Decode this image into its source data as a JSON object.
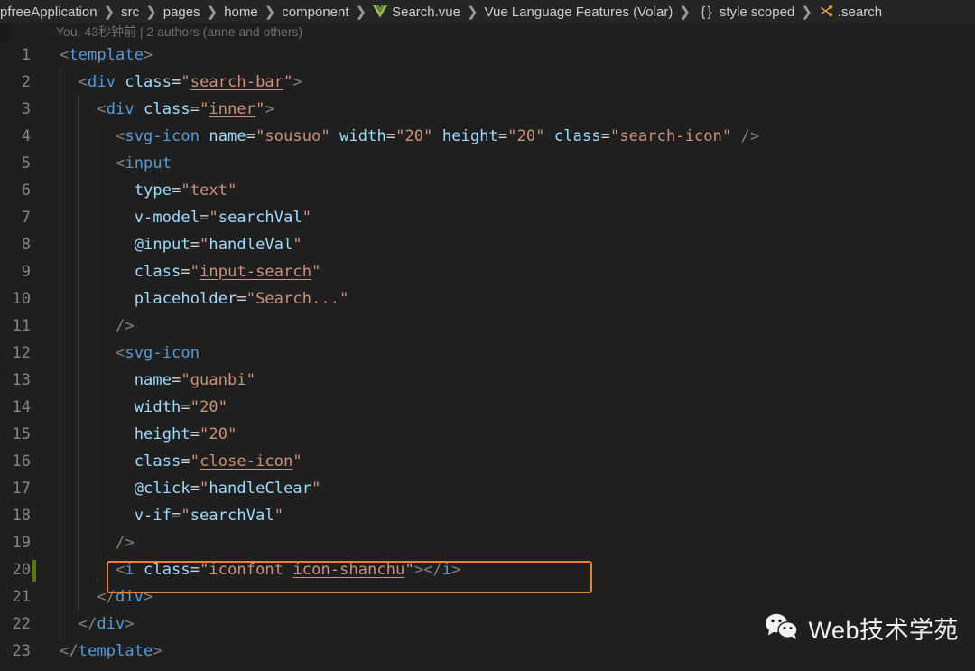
{
  "breadcrumb": {
    "items": [
      {
        "label": "pfreeApplication",
        "icon": "none"
      },
      {
        "label": "src",
        "icon": "none"
      },
      {
        "label": "pages",
        "icon": "none"
      },
      {
        "label": "home",
        "icon": "none"
      },
      {
        "label": "component",
        "icon": "none"
      },
      {
        "label": "Search.vue",
        "icon": "vue-file-icon"
      },
      {
        "label": "Vue Language Features (Volar)",
        "icon": "none"
      },
      {
        "label": "style scoped",
        "icon": "braces-icon"
      },
      {
        "label": ".search",
        "icon": "css-selector-icon"
      }
    ],
    "separator": "❯"
  },
  "blame": {
    "text": "You, 43秒钟前 | 2 authors (anne and others)"
  },
  "editor": {
    "modified_line": 20,
    "highlight_line": 20,
    "lines": [
      {
        "number": "1",
        "indent": 0,
        "tokens": [
          {
            "t": "<",
            "c": "t-punct"
          },
          {
            "t": "template",
            "c": "t-tag"
          },
          {
            "t": ">",
            "c": "t-punct"
          }
        ]
      },
      {
        "number": "2",
        "indent": 1,
        "tokens": [
          {
            "t": "  ",
            "c": "t-punct"
          },
          {
            "t": "<",
            "c": "t-punct"
          },
          {
            "t": "div",
            "c": "t-tag"
          },
          {
            "t": " ",
            "c": "t-punct"
          },
          {
            "t": "class",
            "c": "t-attr"
          },
          {
            "t": "=",
            "c": "t-eq"
          },
          {
            "t": "\"",
            "c": "t-quote"
          },
          {
            "t": "search-bar",
            "c": "t-class"
          },
          {
            "t": "\"",
            "c": "t-quote"
          },
          {
            "t": ">",
            "c": "t-punct"
          }
        ]
      },
      {
        "number": "3",
        "indent": 2,
        "tokens": [
          {
            "t": "    ",
            "c": "t-punct"
          },
          {
            "t": "<",
            "c": "t-punct"
          },
          {
            "t": "div",
            "c": "t-tag"
          },
          {
            "t": " ",
            "c": "t-punct"
          },
          {
            "t": "class",
            "c": "t-attr"
          },
          {
            "t": "=",
            "c": "t-eq"
          },
          {
            "t": "\"",
            "c": "t-quote"
          },
          {
            "t": "inner",
            "c": "t-class"
          },
          {
            "t": "\"",
            "c": "t-quote"
          },
          {
            "t": ">",
            "c": "t-punct"
          }
        ]
      },
      {
        "number": "4",
        "indent": 3,
        "tokens": [
          {
            "t": "      ",
            "c": "t-punct"
          },
          {
            "t": "<",
            "c": "t-punct"
          },
          {
            "t": "svg-icon",
            "c": "t-tag"
          },
          {
            "t": " ",
            "c": "t-punct"
          },
          {
            "t": "name",
            "c": "t-attr"
          },
          {
            "t": "=",
            "c": "t-eq"
          },
          {
            "t": "\"",
            "c": "t-quote"
          },
          {
            "t": "sousuo",
            "c": "t-string"
          },
          {
            "t": "\"",
            "c": "t-quote"
          },
          {
            "t": " ",
            "c": "t-punct"
          },
          {
            "t": "width",
            "c": "t-attr"
          },
          {
            "t": "=",
            "c": "t-eq"
          },
          {
            "t": "\"",
            "c": "t-quote"
          },
          {
            "t": "20",
            "c": "t-string"
          },
          {
            "t": "\"",
            "c": "t-quote"
          },
          {
            "t": " ",
            "c": "t-punct"
          },
          {
            "t": "height",
            "c": "t-attr"
          },
          {
            "t": "=",
            "c": "t-eq"
          },
          {
            "t": "\"",
            "c": "t-quote"
          },
          {
            "t": "20",
            "c": "t-string"
          },
          {
            "t": "\"",
            "c": "t-quote"
          },
          {
            "t": " ",
            "c": "t-punct"
          },
          {
            "t": "class",
            "c": "t-attr"
          },
          {
            "t": "=",
            "c": "t-eq"
          },
          {
            "t": "\"",
            "c": "t-quote"
          },
          {
            "t": "search-icon",
            "c": "t-class"
          },
          {
            "t": "\"",
            "c": "t-quote"
          },
          {
            "t": " />",
            "c": "t-punct"
          }
        ]
      },
      {
        "number": "5",
        "indent": 3,
        "tokens": [
          {
            "t": "      ",
            "c": "t-punct"
          },
          {
            "t": "<",
            "c": "t-punct"
          },
          {
            "t": "input",
            "c": "t-tag"
          }
        ]
      },
      {
        "number": "6",
        "indent": 3,
        "tokens": [
          {
            "t": "        ",
            "c": "t-punct"
          },
          {
            "t": "type",
            "c": "t-attr"
          },
          {
            "t": "=",
            "c": "t-eq"
          },
          {
            "t": "\"",
            "c": "t-quote"
          },
          {
            "t": "text",
            "c": "t-string"
          },
          {
            "t": "\"",
            "c": "t-quote"
          }
        ]
      },
      {
        "number": "7",
        "indent": 3,
        "tokens": [
          {
            "t": "        ",
            "c": "t-punct"
          },
          {
            "t": "v-model",
            "c": "t-attr"
          },
          {
            "t": "=",
            "c": "t-eq"
          },
          {
            "t": "\"",
            "c": "t-quote"
          },
          {
            "t": "searchVal",
            "c": "t-attr"
          },
          {
            "t": "\"",
            "c": "t-quote"
          }
        ]
      },
      {
        "number": "8",
        "indent": 3,
        "tokens": [
          {
            "t": "        ",
            "c": "t-punct"
          },
          {
            "t": "@input",
            "c": "t-attr"
          },
          {
            "t": "=",
            "c": "t-eq"
          },
          {
            "t": "\"",
            "c": "t-quote"
          },
          {
            "t": "handleVal",
            "c": "t-attr"
          },
          {
            "t": "\"",
            "c": "t-quote"
          }
        ]
      },
      {
        "number": "9",
        "indent": 3,
        "tokens": [
          {
            "t": "        ",
            "c": "t-punct"
          },
          {
            "t": "class",
            "c": "t-attr"
          },
          {
            "t": "=",
            "c": "t-eq"
          },
          {
            "t": "\"",
            "c": "t-quote"
          },
          {
            "t": "input-search",
            "c": "t-class"
          },
          {
            "t": "\"",
            "c": "t-quote"
          }
        ]
      },
      {
        "number": "10",
        "indent": 3,
        "tokens": [
          {
            "t": "        ",
            "c": "t-punct"
          },
          {
            "t": "placeholder",
            "c": "t-attr"
          },
          {
            "t": "=",
            "c": "t-eq"
          },
          {
            "t": "\"",
            "c": "t-quote"
          },
          {
            "t": "Search...",
            "c": "t-string"
          },
          {
            "t": "\"",
            "c": "t-quote"
          }
        ]
      },
      {
        "number": "11",
        "indent": 3,
        "tokens": [
          {
            "t": "      ",
            "c": "t-punct"
          },
          {
            "t": "/>",
            "c": "t-punct"
          }
        ]
      },
      {
        "number": "12",
        "indent": 3,
        "tokens": [
          {
            "t": "      ",
            "c": "t-punct"
          },
          {
            "t": "<",
            "c": "t-punct"
          },
          {
            "t": "svg-icon",
            "c": "t-tag"
          }
        ]
      },
      {
        "number": "13",
        "indent": 3,
        "tokens": [
          {
            "t": "        ",
            "c": "t-punct"
          },
          {
            "t": "name",
            "c": "t-attr"
          },
          {
            "t": "=",
            "c": "t-eq"
          },
          {
            "t": "\"",
            "c": "t-quote"
          },
          {
            "t": "guanbi",
            "c": "t-string"
          },
          {
            "t": "\"",
            "c": "t-quote"
          }
        ]
      },
      {
        "number": "14",
        "indent": 3,
        "tokens": [
          {
            "t": "        ",
            "c": "t-punct"
          },
          {
            "t": "width",
            "c": "t-attr"
          },
          {
            "t": "=",
            "c": "t-eq"
          },
          {
            "t": "\"",
            "c": "t-quote"
          },
          {
            "t": "20",
            "c": "t-string"
          },
          {
            "t": "\"",
            "c": "t-quote"
          }
        ]
      },
      {
        "number": "15",
        "indent": 3,
        "tokens": [
          {
            "t": "        ",
            "c": "t-punct"
          },
          {
            "t": "height",
            "c": "t-attr"
          },
          {
            "t": "=",
            "c": "t-eq"
          },
          {
            "t": "\"",
            "c": "t-quote"
          },
          {
            "t": "20",
            "c": "t-string"
          },
          {
            "t": "\"",
            "c": "t-quote"
          }
        ]
      },
      {
        "number": "16",
        "indent": 3,
        "tokens": [
          {
            "t": "        ",
            "c": "t-punct"
          },
          {
            "t": "class",
            "c": "t-attr"
          },
          {
            "t": "=",
            "c": "t-eq"
          },
          {
            "t": "\"",
            "c": "t-quote"
          },
          {
            "t": "close-icon",
            "c": "t-class"
          },
          {
            "t": "\"",
            "c": "t-quote"
          }
        ]
      },
      {
        "number": "17",
        "indent": 3,
        "tokens": [
          {
            "t": "        ",
            "c": "t-punct"
          },
          {
            "t": "@click",
            "c": "t-attr"
          },
          {
            "t": "=",
            "c": "t-eq"
          },
          {
            "t": "\"",
            "c": "t-quote"
          },
          {
            "t": "handleClear",
            "c": "t-attr"
          },
          {
            "t": "\"",
            "c": "t-quote"
          }
        ]
      },
      {
        "number": "18",
        "indent": 3,
        "tokens": [
          {
            "t": "        ",
            "c": "t-punct"
          },
          {
            "t": "v-if",
            "c": "t-attr"
          },
          {
            "t": "=",
            "c": "t-eq"
          },
          {
            "t": "\"",
            "c": "t-quote"
          },
          {
            "t": "searchVal",
            "c": "t-attr"
          },
          {
            "t": "\"",
            "c": "t-quote"
          }
        ]
      },
      {
        "number": "19",
        "indent": 3,
        "tokens": [
          {
            "t": "      ",
            "c": "t-punct"
          },
          {
            "t": "/>",
            "c": "t-punct"
          }
        ]
      },
      {
        "number": "20",
        "indent": 3,
        "tokens": [
          {
            "t": "      ",
            "c": "t-punct"
          },
          {
            "t": "<",
            "c": "t-punct"
          },
          {
            "t": "i",
            "c": "t-tag"
          },
          {
            "t": " ",
            "c": "t-punct"
          },
          {
            "t": "class",
            "c": "t-attr"
          },
          {
            "t": "=",
            "c": "t-eq"
          },
          {
            "t": "\"",
            "c": "t-quote"
          },
          {
            "t": "iconfont ",
            "c": "t-string"
          },
          {
            "t": "icon-shanchu",
            "c": "t-class"
          },
          {
            "t": "\"",
            "c": "t-quote"
          },
          {
            "t": "></",
            "c": "t-punct"
          },
          {
            "t": "i",
            "c": "t-tag"
          },
          {
            "t": ">",
            "c": "t-punct"
          }
        ]
      },
      {
        "number": "21",
        "indent": 2,
        "tokens": [
          {
            "t": "    ",
            "c": "t-punct"
          },
          {
            "t": "</",
            "c": "t-punct"
          },
          {
            "t": "div",
            "c": "t-tag"
          },
          {
            "t": ">",
            "c": "t-punct"
          }
        ]
      },
      {
        "number": "22",
        "indent": 1,
        "tokens": [
          {
            "t": "  ",
            "c": "t-punct"
          },
          {
            "t": "</",
            "c": "t-punct"
          },
          {
            "t": "div",
            "c": "t-tag"
          },
          {
            "t": ">",
            "c": "t-punct"
          }
        ]
      },
      {
        "number": "23",
        "indent": 0,
        "tokens": [
          {
            "t": "</",
            "c": "t-punct"
          },
          {
            "t": "template",
            "c": "t-tag"
          },
          {
            "t": ">",
            "c": "t-punct"
          }
        ]
      }
    ]
  },
  "watermark": {
    "text": "Web技术学苑",
    "icon": "wechat-icon"
  },
  "colors": {
    "background": "#1f1f1f",
    "breadcrumb_bg": "#252526",
    "highlight_border": "#e8813a",
    "gutter_modified": "#587c0c",
    "tag": "#569cd6",
    "attr": "#9cdcfe",
    "string": "#ce9178",
    "punct": "#808080"
  }
}
